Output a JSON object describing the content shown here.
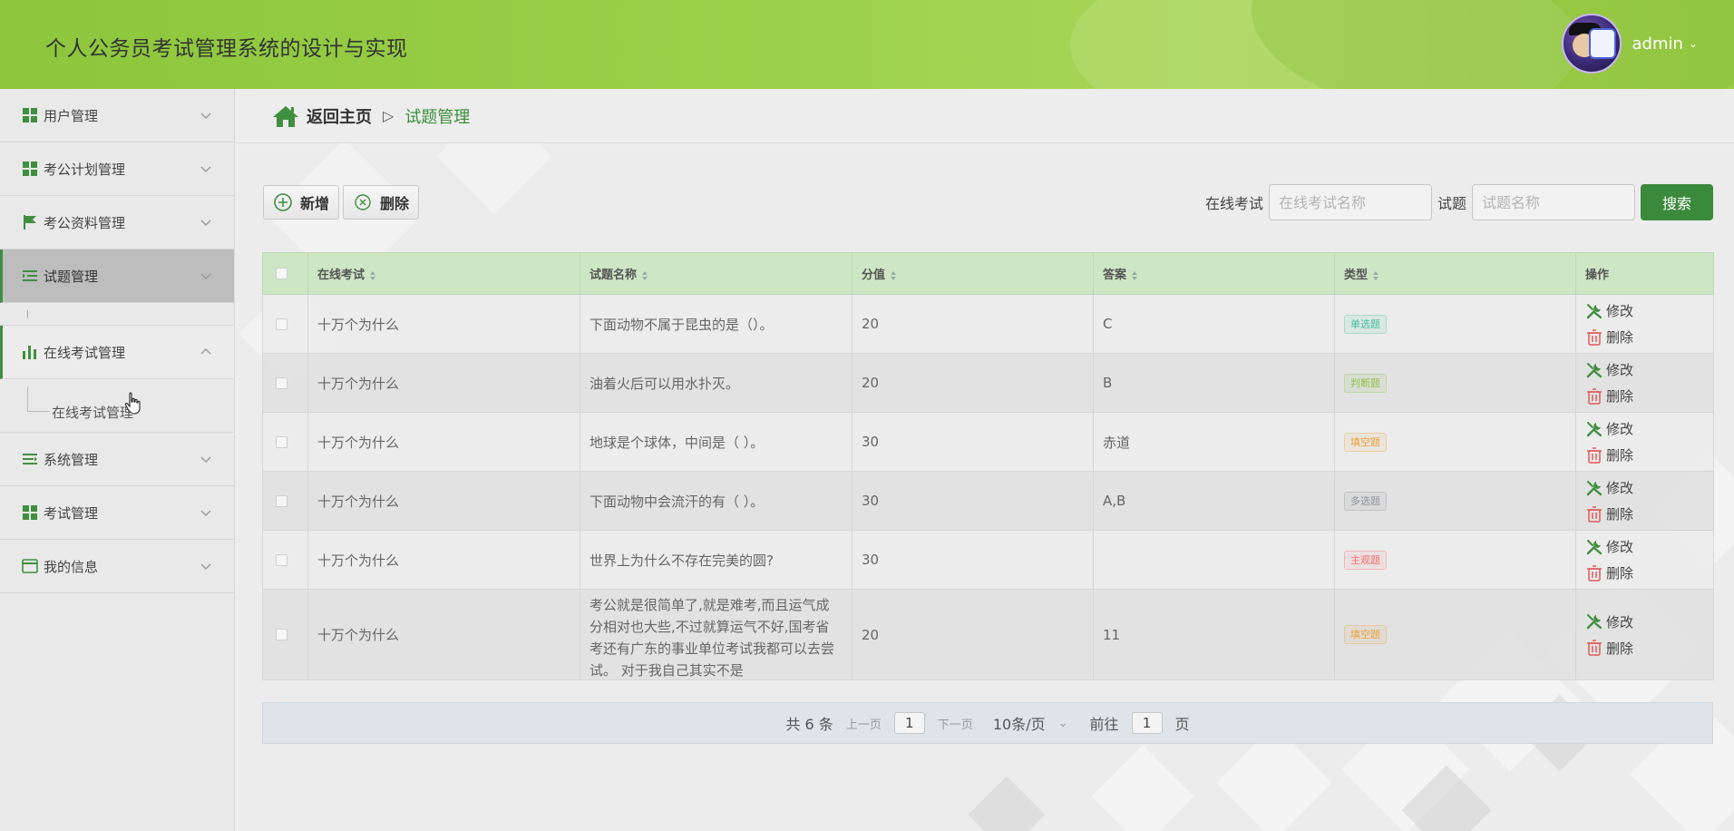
{
  "header": {
    "title": "个人公务员考试管理系统的设计与实现",
    "user": "admin",
    "accent": "#8cc63c"
  },
  "sidebar": {
    "items": [
      {
        "label": "用户管理",
        "icon": "grid-icon"
      },
      {
        "label": "考公计划管理",
        "icon": "grid-icon"
      },
      {
        "label": "考公资料管理",
        "icon": "flag-icon"
      },
      {
        "label": "试题管理",
        "icon": "list-indent-icon"
      },
      {
        "label": "在线考试管理",
        "icon": "bar-chart-icon"
      },
      {
        "label": "系统管理",
        "icon": "menu-lines-icon"
      },
      {
        "label": "考试管理",
        "icon": "grid-icon"
      },
      {
        "label": "我的信息",
        "icon": "card-icon"
      }
    ],
    "submenu": {
      "label": "在线考试管理"
    }
  },
  "breadcrumb": {
    "home": "返回主页",
    "separator": "▷",
    "current": "试题管理"
  },
  "toolbar": {
    "add_label": "新增",
    "delete_label": "删除"
  },
  "search": {
    "exam_label": "在线考试",
    "exam_placeholder": "在线考试名称",
    "question_label": "试题",
    "question_placeholder": "试题名称",
    "button_label": "搜索"
  },
  "table": {
    "columns": [
      "在线考试",
      "试题名称",
      "分值",
      "答案",
      "类型",
      "操作"
    ],
    "ops": {
      "edit": "修改",
      "delete": "删除"
    },
    "rows": [
      {
        "exam": "十万个为什么",
        "name": "下面动物不属于昆虫的是（）。",
        "score": "20",
        "answer": "C",
        "type": "单选题",
        "type_color": "#3fbf9a"
      },
      {
        "exam": "十万个为什么",
        "name": "油着火后可以用水扑灭。",
        "score": "20",
        "answer": "B",
        "type": "判断题",
        "type_color": "#8bc34a"
      },
      {
        "exam": "十万个为什么",
        "name": "地球是个球体，中间是（ ）。",
        "score": "30",
        "answer": "赤道",
        "type": "填空题",
        "type_color": "#e6a23c"
      },
      {
        "exam": "十万个为什么",
        "name": "下面动物中会流汗的有（ ）。",
        "score": "30",
        "answer": "A,B",
        "type": "多选题",
        "type_color": "#909399"
      },
      {
        "exam": "十万个为什么",
        "name": "世界上为什么不存在完美的圆?",
        "score": "30",
        "answer": "",
        "type": "主观题",
        "type_color": "#f56c6c"
      },
      {
        "exam": "十万个为什么",
        "name": "考公就是很简单了,就是难考,而且运气成分相对也大些,不过就算运气不好,国考省考还有广东的事业单位考试我都可以去尝试。 对于我自己其实不是",
        "score": "20",
        "answer": "11",
        "type": "填空题",
        "type_color": "#e6a23c"
      }
    ]
  },
  "pager": {
    "total": "共 6 条",
    "prev": "上一页",
    "page": "1",
    "next": "下一页",
    "size": "10条/页",
    "goto_prefix": "前往",
    "goto_page": "1",
    "goto_suffix": "页"
  }
}
